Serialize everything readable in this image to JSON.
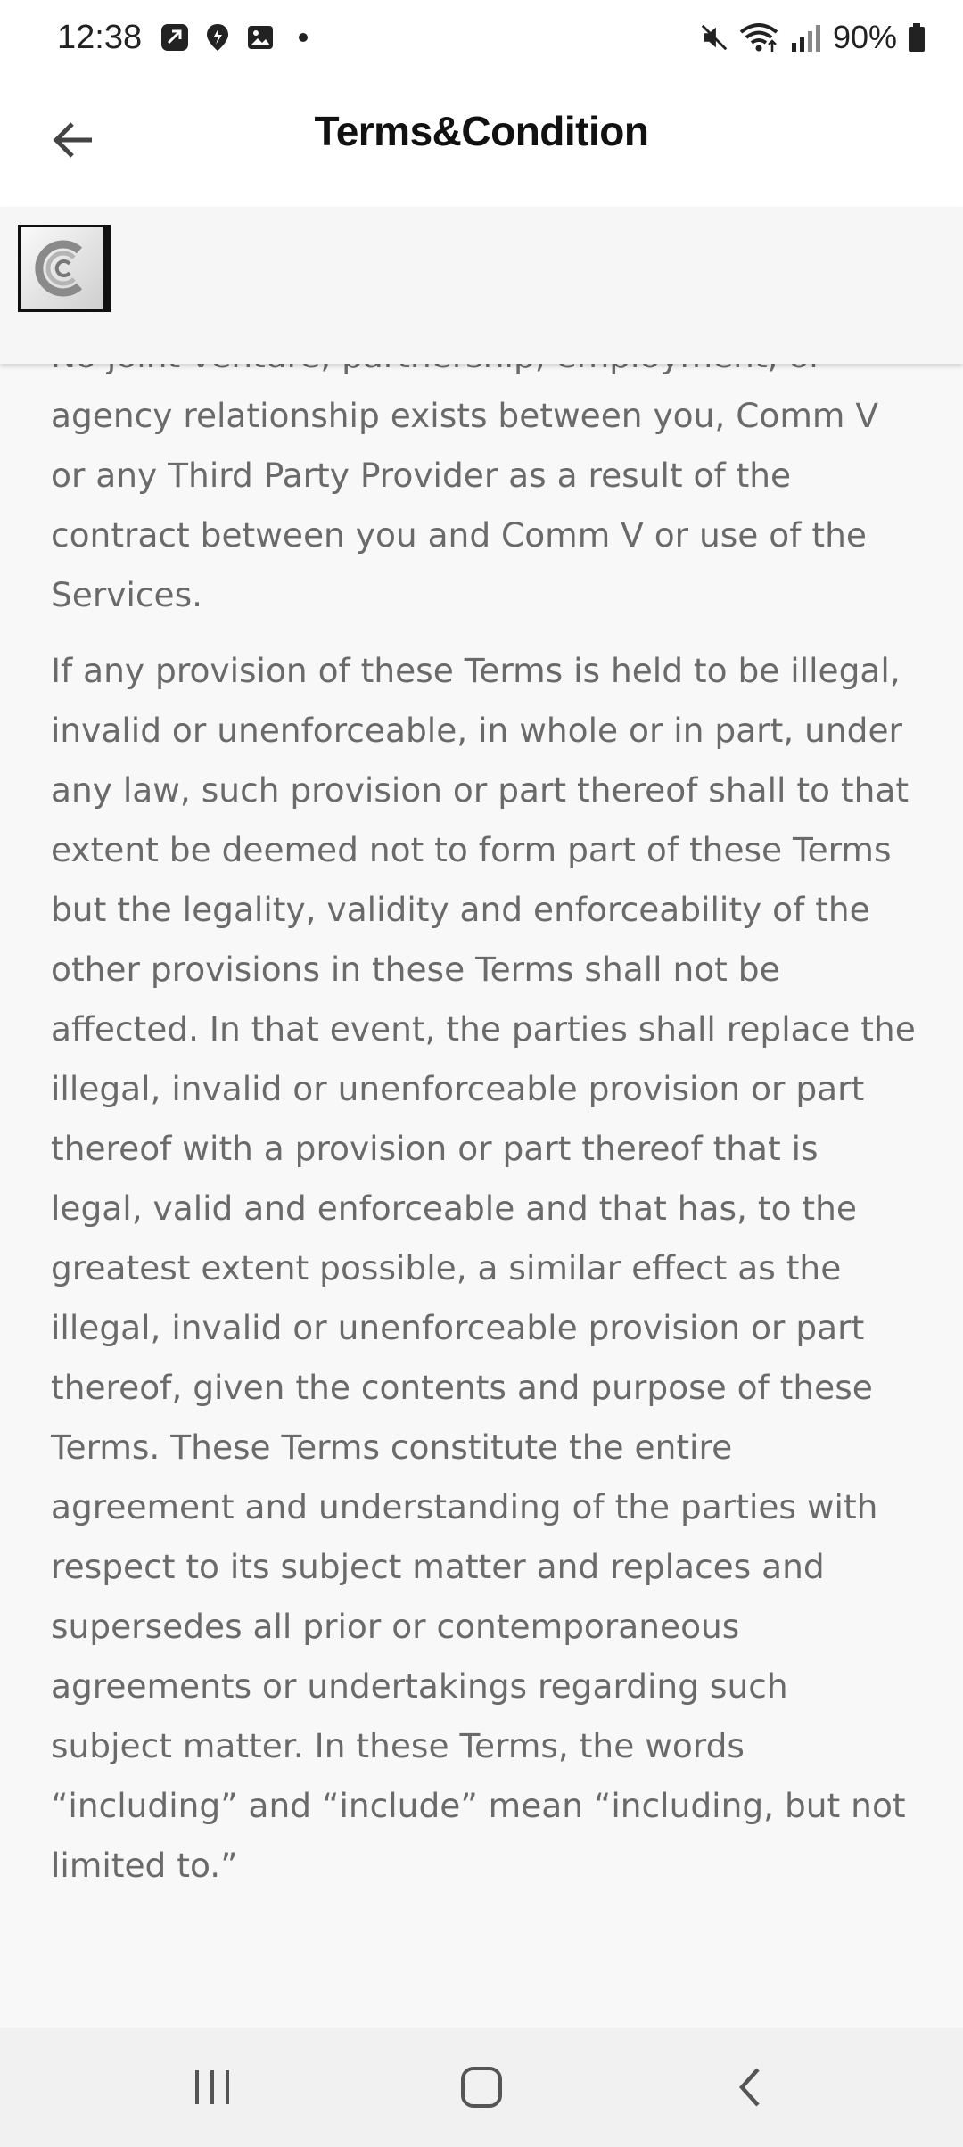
{
  "status_bar": {
    "time": "12:38",
    "battery": "90%",
    "left_icons": [
      "app-notification-icon",
      "location-notification-icon",
      "gallery-notification-icon",
      "more-dot-icon"
    ],
    "right_icons": [
      "mute-icon",
      "wifi-icon",
      "signal-icon",
      "battery-icon"
    ]
  },
  "app_bar": {
    "title": "Terms&Condition",
    "back_icon": "back-arrow-icon"
  },
  "logo": {
    "icon": "company-logo"
  },
  "content": {
    "paragraphs": [
      "No joint venture, partnership, employment, or agency relationship exists between you, Comm V  or any Third Party Provider as a result of the contract between you and Comm V  or use of the Services.",
      "If any provision of these Terms is held to be illegal, invalid or unenforceable, in whole or in part, under any law, such provision or part thereof shall to that extent be deemed not to form part of these Terms but the legality, validity and enforceability of the other provisions in these Terms shall not be affected. In that event, the parties shall replace the illegal, invalid or unenforceable provision or part thereof with a provision or part thereof that is legal, valid and enforceable and that has, to the greatest extent possible, a similar effect as the illegal, invalid or unenforceable provision or part thereof, given the contents and purpose of these Terms. These Terms constitute the entire agreement and understanding of the parties with respect to its subject matter and replaces and supersedes all prior or contemporaneous agreements or undertakings regarding such subject matter. In these Terms, the words “including” and “include” mean “including, but not limited to.”"
    ]
  },
  "nav_bar": {
    "recents_icon": "recent-apps-icon",
    "home_icon": "home-icon",
    "back_icon": "nav-back-icon"
  },
  "colors": {
    "background": "#f8f8f8",
    "text": "#6a6a6a",
    "title": "#111111",
    "nav_bar": "#f1f1f1"
  }
}
